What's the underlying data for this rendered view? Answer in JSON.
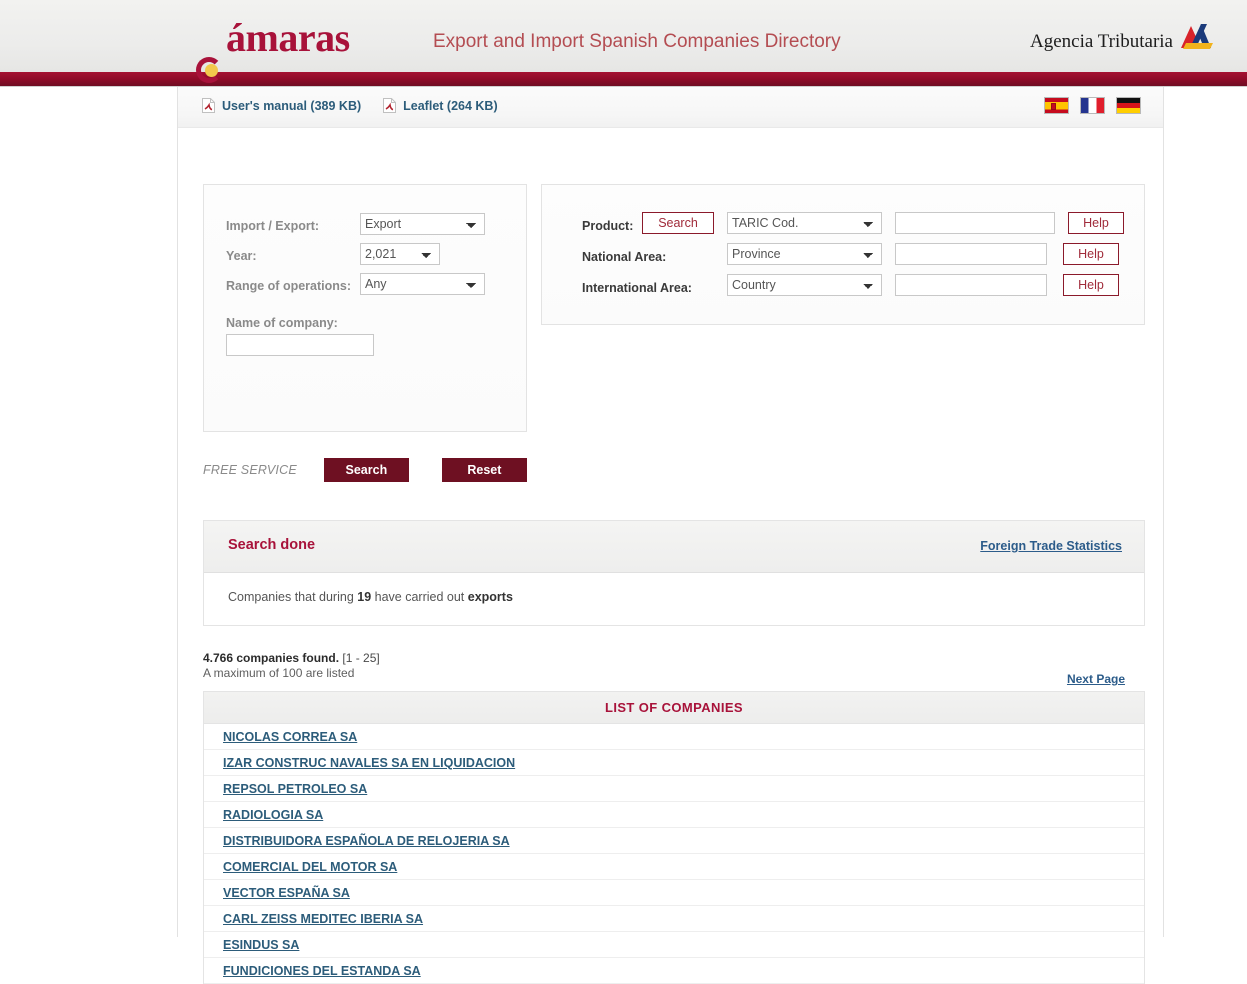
{
  "header": {
    "logo_text": "ámaras",
    "logo_initial": "C",
    "title": "Export and Import Spanish Companies Directory",
    "agency_name": "Agencia Tributaria",
    "agency_mark_icon": "agencia-tributaria-arrow-icon",
    "band_color": "#8d0b28",
    "brand_color": "#a8123a",
    "title_color": "#b44d52"
  },
  "utility_bar": {
    "pdf_links": [
      {
        "label": "User's manual (389 KB)",
        "icon": "pdf-icon"
      },
      {
        "label": "Leaflet (264 KB)",
        "icon": "pdf-icon"
      }
    ],
    "flags": [
      {
        "name": "flag-spanish",
        "title": "Español"
      },
      {
        "name": "flag-french",
        "title": "Français"
      },
      {
        "name": "flag-german",
        "title": "Deutsch"
      }
    ]
  },
  "form": {
    "left": {
      "import_export": {
        "label": "Import / Export:",
        "value": "Export"
      },
      "year": {
        "label": "Year:",
        "value": "2,021"
      },
      "range_of_operations": {
        "label": "Range of operations:",
        "value": "Any"
      },
      "name_of_company": {
        "label": "Name of company:",
        "value": "",
        "placeholder": ""
      }
    },
    "right": {
      "product": {
        "label": "Product:",
        "search_button": "Search",
        "select_value": "TARIC Cod.",
        "text_value": "",
        "help_button": "Help"
      },
      "national_area": {
        "label": "National Area:",
        "select_value": "Province",
        "text_value": "",
        "help_button": "Help"
      },
      "international_area": {
        "label": "International Area:",
        "select_value": "Country",
        "text_value": "",
        "help_button": "Help"
      }
    }
  },
  "actions": {
    "free_service": "FREE SERVICE",
    "search_button": "Search",
    "reset_button": "Reset"
  },
  "result": {
    "title": "Search done",
    "statistics_link": "Foreign Trade Statistics",
    "summary_prefix": "Companies that during ",
    "summary_year": "19",
    "summary_middle": " have carried out ",
    "summary_operation": "exports"
  },
  "list": {
    "count_line": "4.766 companies found.",
    "range_line": " [1 - 25]",
    "max_line": "A maximum of 100 are listed",
    "next_page": "Next Page",
    "table_title": "LIST OF COMPANIES",
    "companies": [
      "NICOLAS CORREA SA",
      "IZAR CONSTRUC NAVALES SA EN LIQUIDACION",
      "REPSOL PETROLEO SA",
      "RADIOLOGIA SA",
      "DISTRIBUIDORA ESPAÑOLA DE RELOJERIA SA",
      "COMERCIAL DEL MOTOR SA",
      "VECTOR ESPAÑA SA",
      "CARL ZEISS MEDITEC IBERIA SA",
      "ESINDUS SA",
      "FUNDICIONES DEL ESTANDA SA"
    ]
  }
}
